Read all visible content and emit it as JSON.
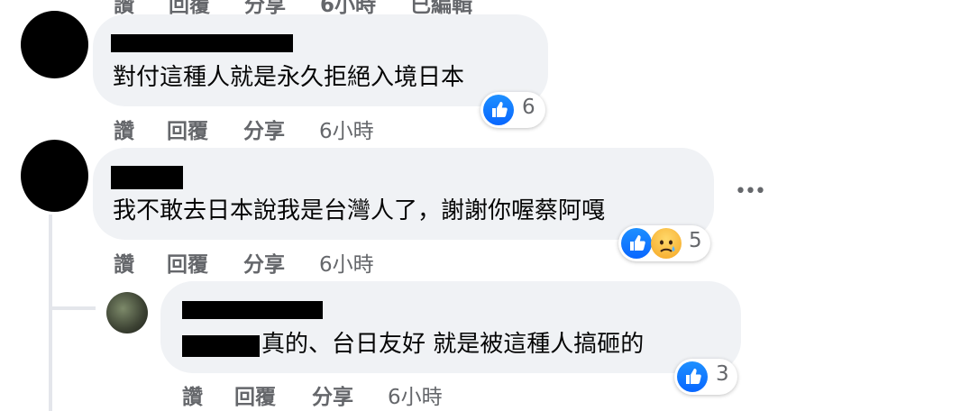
{
  "actions": {
    "like": "讚",
    "reply": "回覆",
    "share": "分享"
  },
  "top_partial": "讚 回覆 分享 6小時 已編輯",
  "comments": [
    {
      "text": "對付這種人就是永久拒絕入境日本",
      "time": "6小時",
      "reactions": {
        "count": "6",
        "icons": [
          "like-icon"
        ]
      }
    },
    {
      "text": "我不敢去日本說我是台灣人了，謝謝你喔蔡阿嘎",
      "time": "6小時",
      "reactions": {
        "count": "5",
        "icons": [
          "like-icon",
          "sad-icon"
        ]
      },
      "more_label": "•••"
    },
    {
      "text": " 真的、台日友好 就是被這種人搞砸的",
      "time": "6小時",
      "reactions": {
        "count": "3",
        "icons": [
          "like-icon"
        ]
      }
    }
  ],
  "colors": {
    "bubble": "#f0f2f5",
    "like": "#0866ff",
    "meta": "#65676b"
  }
}
